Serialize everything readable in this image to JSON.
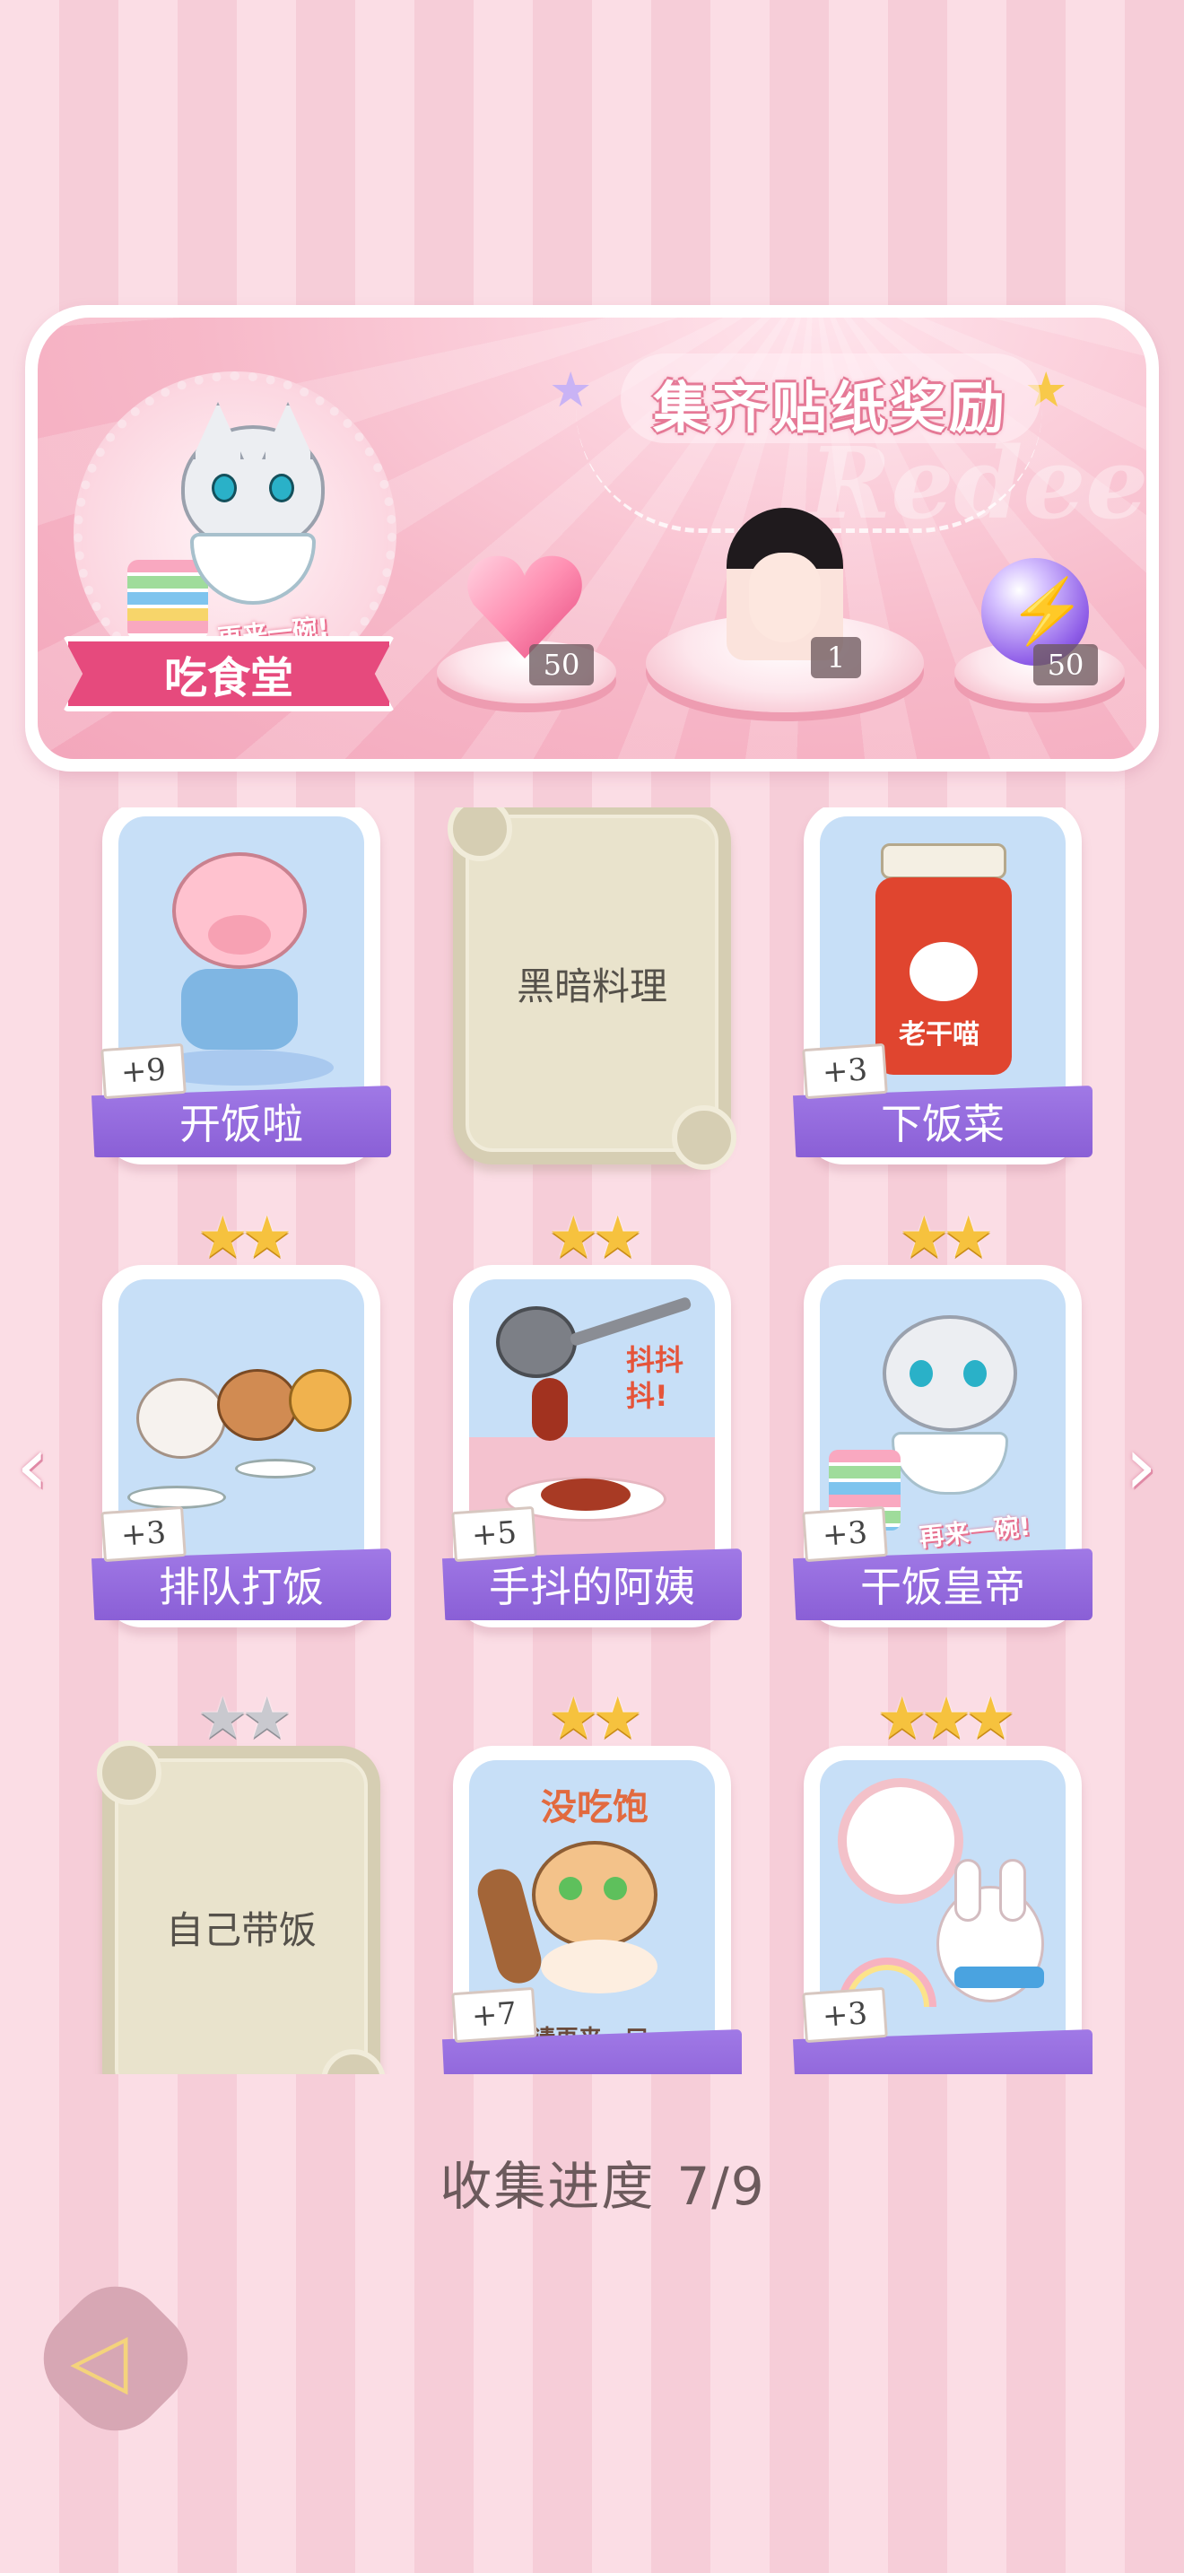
{
  "banner": {
    "title": "集齐贴纸奖励",
    "watermark": "Redeem",
    "album_label": "吃食堂",
    "album_caption": "再来一碗!",
    "rewards": [
      {
        "icon": "heart-gem-icon",
        "count": "50"
      },
      {
        "icon": "portrait-icon",
        "count": "1"
      },
      {
        "icon": "energy-orb-icon",
        "count": "50"
      }
    ]
  },
  "cards": [
    {
      "name": "开饭啦",
      "bonus": "+9",
      "stars": 0,
      "locked": false
    },
    {
      "name": "黑暗料理",
      "bonus": "",
      "stars": 0,
      "locked": true
    },
    {
      "name": "下饭菜",
      "bonus": "+3",
      "stars": 0,
      "locked": false,
      "art_text": "老干喵"
    },
    {
      "name": "排队打饭",
      "bonus": "+3",
      "stars": 2,
      "locked": false
    },
    {
      "name": "手抖的阿姨",
      "bonus": "+5",
      "stars": 2,
      "locked": false,
      "art_text": "抖抖抖!"
    },
    {
      "name": "干饭皇帝",
      "bonus": "+3",
      "stars": 2,
      "locked": false,
      "art_text": "再来一碗!"
    },
    {
      "name": "自己带饭",
      "bonus": "",
      "stars": 2,
      "locked": true
    },
    {
      "name": "",
      "bonus": "+7",
      "stars": 2,
      "locked": false,
      "art_text": "没吃饱",
      "art_text2": "请再来一口"
    },
    {
      "name": "",
      "bonus": "+3",
      "stars": 3,
      "locked": false
    }
  ],
  "progress": {
    "label": "收集进度",
    "value": "7/9"
  },
  "nav": {
    "prev": "‹",
    "next": "›",
    "back": "◁"
  },
  "colors": {
    "accent_purple": "#9b6fe2",
    "banner_pink": "#f7b9c9",
    "star_gold": "#f6c23e"
  }
}
